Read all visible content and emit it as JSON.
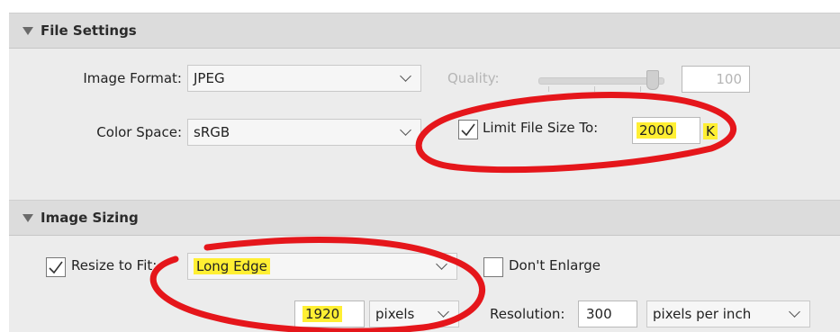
{
  "file_settings": {
    "title": "File Settings",
    "image_format_label": "Image Format:",
    "image_format_value": "JPEG",
    "quality_label": "Quality:",
    "quality_value": "100",
    "color_space_label": "Color Space:",
    "color_space_value": "sRGB",
    "limit_file_size_label": "Limit File Size To:",
    "limit_file_size_checked": true,
    "limit_file_size_value": "2000",
    "limit_file_size_unit": "K"
  },
  "image_sizing": {
    "title": "Image Sizing",
    "resize_to_fit_label": "Resize to Fit:",
    "resize_to_fit_checked": true,
    "resize_mode_value": "Long Edge",
    "dont_enlarge_label": "Don't Enlarge",
    "dont_enlarge_checked": false,
    "size_value": "1920",
    "size_unit_value": "pixels",
    "resolution_label": "Resolution:",
    "resolution_value": "300",
    "resolution_unit_value": "pixels per inch"
  },
  "colors": {
    "highlight": "#ffef33",
    "annotation": "#e5161b",
    "panel": "#ececec",
    "header": "#dcdcdc"
  }
}
